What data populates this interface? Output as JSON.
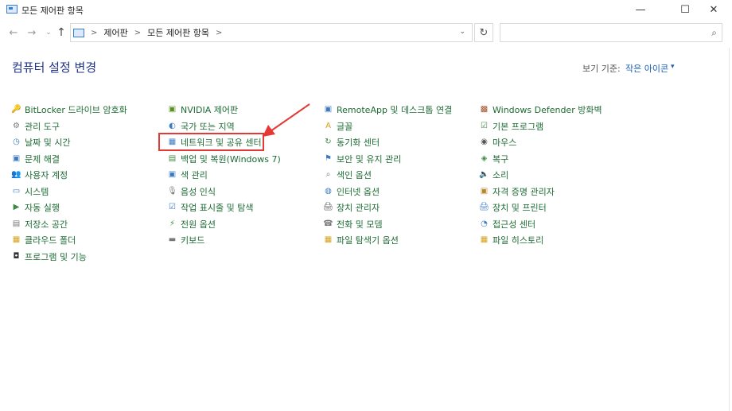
{
  "window": {
    "title": "모든 제어판 항목",
    "min_symbol": "—",
    "max_symbol": "☐",
    "close_symbol": "✕"
  },
  "nav": {
    "back_symbol": "←",
    "forward_symbol": "→",
    "recent_symbol": "⌄",
    "up_symbol": "↑",
    "breadcrumb": [
      "제어판",
      "모든 제어판 항목"
    ],
    "separator": ">",
    "dropdown_symbol": "⌄",
    "refresh_symbol": "↻",
    "search_placeholder": "",
    "search_icon": "⌕"
  },
  "header": {
    "title": "컴퓨터 설정 변경",
    "view_by_label": "보기 기준:",
    "view_by_value": "작은 아이콘",
    "view_caret": "▾"
  },
  "columns": [
    [
      {
        "label": "BitLocker 드라이브 암호화",
        "icon": "bitlocker-icon",
        "glyph": "🔑",
        "color": "#8a6a2a"
      },
      {
        "label": "관리 도구",
        "icon": "admin-tools-icon",
        "glyph": "⚙",
        "color": "#777777"
      },
      {
        "label": "날짜 및 시간",
        "icon": "date-time-icon",
        "glyph": "◷",
        "color": "#3d7bbf"
      },
      {
        "label": "문제 해결",
        "icon": "troubleshoot-icon",
        "glyph": "▣",
        "color": "#3d7bbf"
      },
      {
        "label": "사용자 계정",
        "icon": "user-accounts-icon",
        "glyph": "👥",
        "color": "#3d7bbf"
      },
      {
        "label": "시스템",
        "icon": "system-icon",
        "glyph": "▭",
        "color": "#3d7bbf"
      },
      {
        "label": "자동 실행",
        "icon": "autoplay-icon",
        "glyph": "▶",
        "color": "#3c8a45"
      },
      {
        "label": "저장소 공간",
        "icon": "storage-spaces-icon",
        "glyph": "▤",
        "color": "#777777"
      },
      {
        "label": "클라우드 폴더",
        "icon": "cloud-folder-icon",
        "glyph": "▦",
        "color": "#d4a017"
      },
      {
        "label": "프로그램 및 기능",
        "icon": "programs-features-icon",
        "glyph": "◘",
        "color": "#333333"
      }
    ],
    [
      {
        "label": "NVIDIA 제어판",
        "icon": "nvidia-icon",
        "glyph": "▣",
        "color": "#5a8f1f"
      },
      {
        "label": "국가 또는 지역",
        "icon": "region-icon",
        "glyph": "◐",
        "color": "#3d7bbf"
      },
      {
        "label": "네트워크 및 공유 센터",
        "icon": "network-sharing-icon",
        "glyph": "▦",
        "color": "#3d7bbf"
      },
      {
        "label": "백업 및 복원(Windows 7)",
        "icon": "backup-restore-icon",
        "glyph": "▤",
        "color": "#3c8a45"
      },
      {
        "label": "색 관리",
        "icon": "color-management-icon",
        "glyph": "▣",
        "color": "#3d7bbf"
      },
      {
        "label": "음성 인식",
        "icon": "speech-recognition-icon",
        "glyph": "🎙",
        "color": "#777777"
      },
      {
        "label": "작업 표시줄 및 탐색",
        "icon": "taskbar-icon",
        "glyph": "☑",
        "color": "#3d7bbf"
      },
      {
        "label": "전원 옵션",
        "icon": "power-options-icon",
        "glyph": "⚡",
        "color": "#3c8a45"
      },
      {
        "label": "키보드",
        "icon": "keyboard-icon",
        "glyph": "▬",
        "color": "#777777"
      }
    ],
    [
      {
        "label": "RemoteApp 및 데스크톱 연결",
        "icon": "remoteapp-icon",
        "glyph": "▣",
        "color": "#3d7bbf"
      },
      {
        "label": "글꼴",
        "icon": "fonts-icon",
        "glyph": "A",
        "color": "#d4a017"
      },
      {
        "label": "동기화 센터",
        "icon": "sync-center-icon",
        "glyph": "↻",
        "color": "#3c8a45"
      },
      {
        "label": "보안 및 유지 관리",
        "icon": "security-maintenance-icon",
        "glyph": "⚑",
        "color": "#3d7bbf"
      },
      {
        "label": "색인 옵션",
        "icon": "indexing-options-icon",
        "glyph": "⌕",
        "color": "#777777"
      },
      {
        "label": "인터넷 옵션",
        "icon": "internet-options-icon",
        "glyph": "◍",
        "color": "#3d7bbf"
      },
      {
        "label": "장치 관리자",
        "icon": "device-manager-icon",
        "glyph": "🖨",
        "color": "#555555"
      },
      {
        "label": "전화 및 모뎀",
        "icon": "phone-modem-icon",
        "glyph": "☎",
        "color": "#777777"
      },
      {
        "label": "파일 탐색기 옵션",
        "icon": "file-explorer-options-icon",
        "glyph": "▦",
        "color": "#d4a017"
      }
    ],
    [
      {
        "label": "Windows Defender 방화벽",
        "icon": "firewall-icon",
        "glyph": "▩",
        "color": "#a0522d"
      },
      {
        "label": "기본 프로그램",
        "icon": "default-programs-icon",
        "glyph": "☑",
        "color": "#3c8a45"
      },
      {
        "label": "마우스",
        "icon": "mouse-icon",
        "glyph": "◉",
        "color": "#555555"
      },
      {
        "label": "복구",
        "icon": "recovery-icon",
        "glyph": "◈",
        "color": "#3c8a45"
      },
      {
        "label": "소리",
        "icon": "sound-icon",
        "glyph": "🔈",
        "color": "#777777"
      },
      {
        "label": "자격 증명 관리자",
        "icon": "credential-manager-icon",
        "glyph": "▣",
        "color": "#b8862b"
      },
      {
        "label": "장치 및 프린터",
        "icon": "devices-printers-icon",
        "glyph": "🖨",
        "color": "#3d7bbf"
      },
      {
        "label": "접근성 센터",
        "icon": "ease-of-access-icon",
        "glyph": "◔",
        "color": "#3d7bbf"
      },
      {
        "label": "파일 히스토리",
        "icon": "file-history-icon",
        "glyph": "▦",
        "color": "#d4a017"
      }
    ]
  ],
  "annotation": {
    "highlight_color": "#e53935"
  }
}
